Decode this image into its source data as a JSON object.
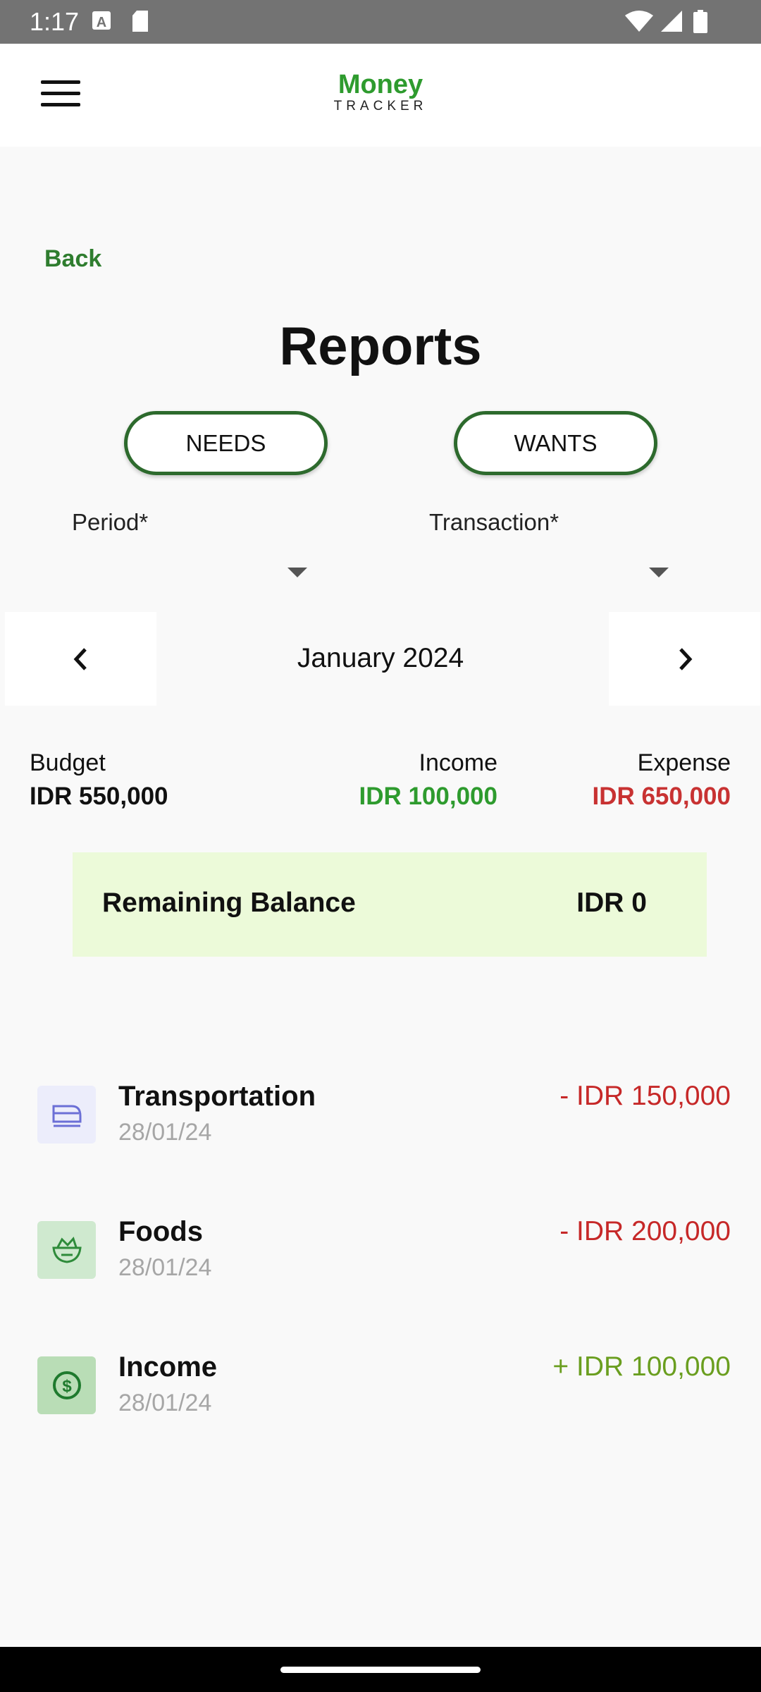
{
  "status_bar": {
    "time": "1:17"
  },
  "app_bar": {
    "logo_line1": "Money",
    "logo_line2": "TRACKER"
  },
  "back_label": "Back",
  "title": "Reports",
  "tabs": [
    {
      "label": "NEEDS"
    },
    {
      "label": "WANTS"
    }
  ],
  "filters": {
    "period_label": "Period*",
    "transaction_label": "Transaction*"
  },
  "month_nav": {
    "label": "January 2024"
  },
  "summary": {
    "budget": {
      "title": "Budget",
      "value": "IDR 550,000"
    },
    "income": {
      "title": "Income",
      "value": "IDR 100,000",
      "color": "#2e9b2e"
    },
    "expense": {
      "title": "Expense",
      "value": "IDR 650,000",
      "color": "#c83232"
    }
  },
  "balance": {
    "label": "Remaining Balance",
    "value": "IDR 0",
    "bg": "#ecfad9"
  },
  "transactions": [
    {
      "title": "Transportation",
      "date": "28/01/24",
      "amount": "- IDR 150,000",
      "icon": "train-icon",
      "amount_color": "#c62828",
      "icon_bg": "#ecedfb"
    },
    {
      "title": "Foods",
      "date": "28/01/24",
      "amount": "- IDR 200,000",
      "icon": "food-bowl-icon",
      "amount_color": "#c62828",
      "icon_bg": "#cfe9cf"
    },
    {
      "title": "Income",
      "date": "28/01/24",
      "amount": "+ IDR 100,000",
      "icon": "dollar-icon",
      "amount_color": "#6a9e1f",
      "icon_bg": "#b9ddb6"
    }
  ]
}
